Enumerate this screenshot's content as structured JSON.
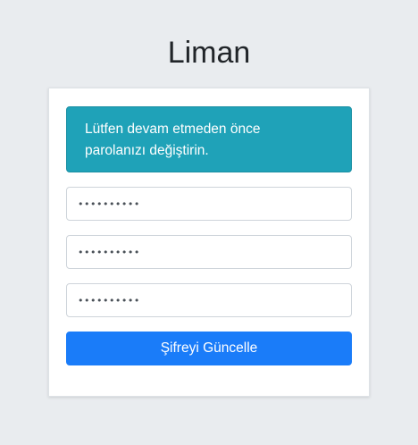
{
  "app": {
    "title": "Liman"
  },
  "alert": {
    "line1": "Lütfen devam etmeden önce",
    "line2": "parolanızı değiştirin."
  },
  "form": {
    "current_password_value": "••••••••••",
    "new_password_value": "••••••••••",
    "confirm_password_value": "••••••••••",
    "submit_label": "Şifreyi Güncelle"
  },
  "colors": {
    "background": "#e9ecef",
    "alert": "#1fa2b8",
    "primary_button": "#1a7cf9"
  }
}
